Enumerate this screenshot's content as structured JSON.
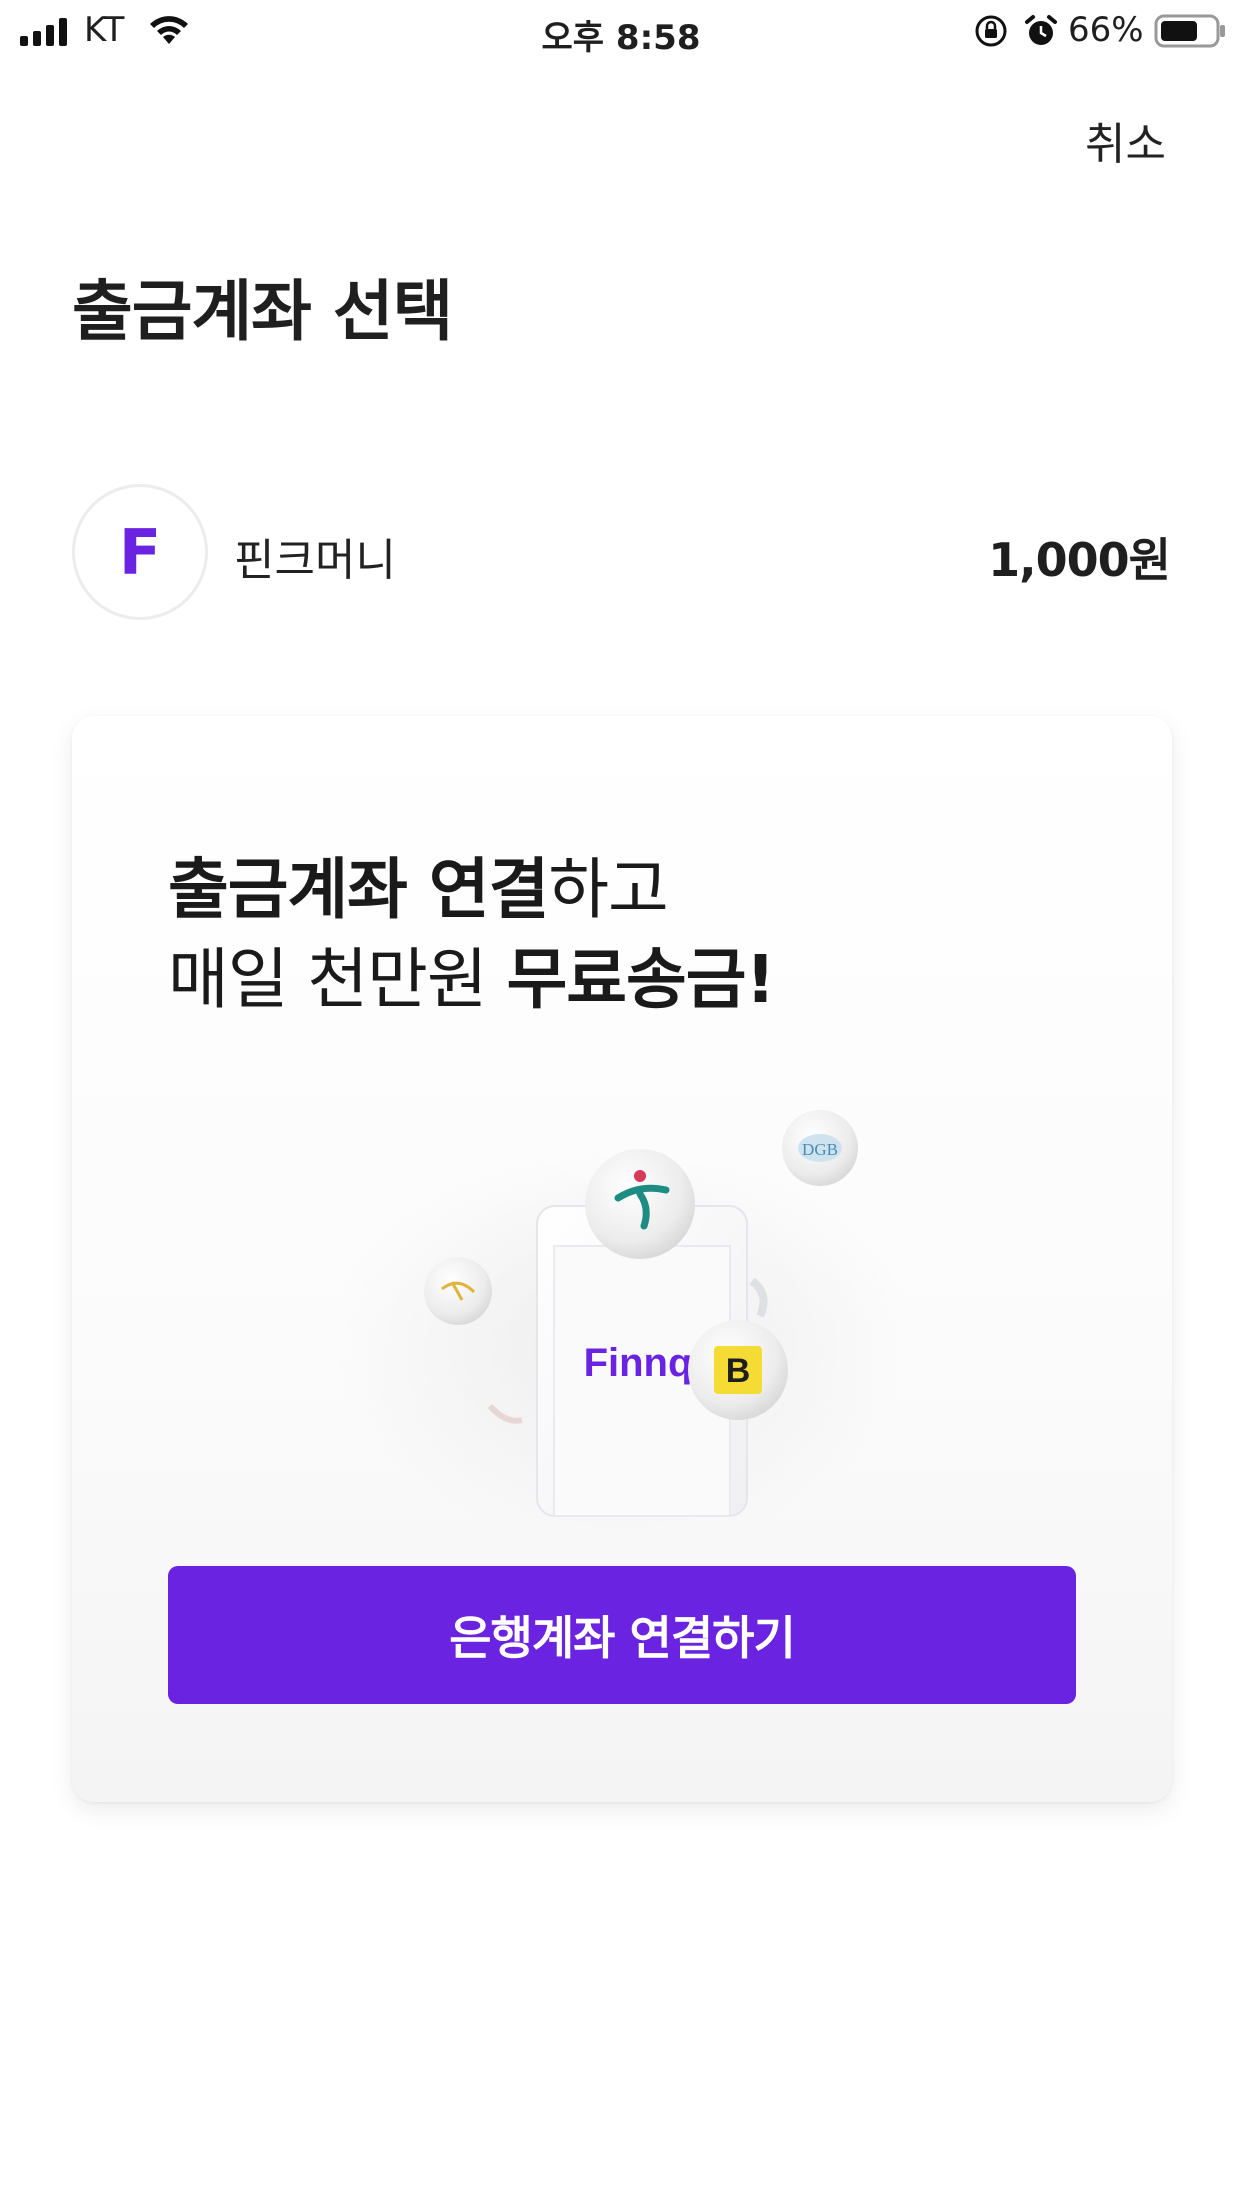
{
  "status_bar": {
    "carrier": "KT",
    "time": "오후 8:58",
    "battery_percent": "66%"
  },
  "header": {
    "cancel_label": "취소",
    "title_bold": "출금계좌",
    "title_regular": " 선택"
  },
  "account": {
    "logo_letter": "F",
    "name": "핀크머니",
    "balance": "1,000원"
  },
  "promo": {
    "line1_bold": "출금계좌 연결",
    "line1_rest": "하고",
    "line2_regular": "매일 천만원 ",
    "line2_bold": "무료송금!",
    "brand_label": "Finnq",
    "badge_letter": "B",
    "dgb_label": "DGB",
    "cta_label": "은행계좌 연결하기"
  },
  "colors": {
    "accent": "#6a23e0",
    "text": "#1f1f1f"
  }
}
